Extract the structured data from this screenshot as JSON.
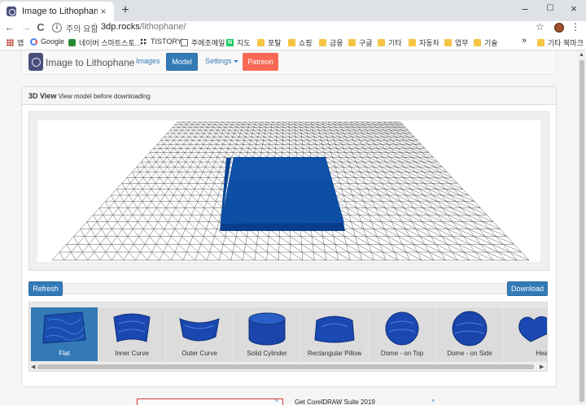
{
  "browser": {
    "tab_title": "Image to Lithophane",
    "tab_close": "×",
    "new_tab": "+",
    "window_controls": {
      "minimize": "–",
      "maximize": "☐",
      "close": "×"
    },
    "nav": {
      "back": "←",
      "forward": "→",
      "reload": "C"
    },
    "address": {
      "info_glyph": "i",
      "warning": "주의 요함",
      "host": "3dp.rocks",
      "path": "/lithophane/"
    },
    "star": "☆",
    "menu": "⋮"
  },
  "bookmarks": {
    "apps": "앱",
    "items": [
      "Google",
      "네이버 스마트스토...",
      "TISTORY",
      "주에조메일",
      "지도",
      "포탈",
      "쇼핑",
      "금융",
      "구글",
      "기타",
      "자동차",
      "업무",
      "기술"
    ],
    "overflow": "»",
    "other": "기타 북마크"
  },
  "site": {
    "brand": "Image to Lithophane",
    "nav": {
      "images": "Images",
      "model": "Model",
      "settings": "Settings",
      "patreon": "Patreon"
    }
  },
  "panel": {
    "title": "3D View",
    "subtitle": "View model before downloading",
    "refresh": "Refresh",
    "download": "Download"
  },
  "gallery": {
    "items": [
      {
        "label": "Flat",
        "selected": true
      },
      {
        "label": "Inner Curve",
        "selected": false
      },
      {
        "label": "Outer Curve",
        "selected": false
      },
      {
        "label": "Solid Cylinder",
        "selected": false
      },
      {
        "label": "Rectangular Pillow",
        "selected": false
      },
      {
        "label": "Dome - on Top",
        "selected": false
      },
      {
        "label": "Dome - on Side",
        "selected": false
      },
      {
        "label": "Hea",
        "selected": false
      }
    ],
    "scroll_left": "◀",
    "scroll_right": "▶"
  },
  "ad": {
    "text": "Get CorelDRAW Suite 2019",
    "close": "×"
  },
  "colors": {
    "model_blue": "#0d47a1",
    "primary": "#337ab7",
    "patreon": "#f96854"
  }
}
